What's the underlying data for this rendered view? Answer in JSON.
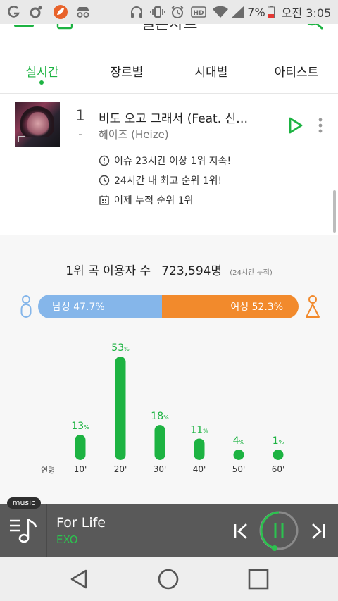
{
  "status_bar": {
    "battery": "7%",
    "time": "오전 3:05"
  },
  "header": {
    "title": "멜론차트",
    "menu_icon": "menu-icon",
    "search_icon": "search-icon"
  },
  "tabs": [
    {
      "label": "실시간",
      "active": true
    },
    {
      "label": "장르별",
      "active": false
    },
    {
      "label": "시대별",
      "active": false
    },
    {
      "label": "아티스트",
      "active": false
    }
  ],
  "song": {
    "rank": "1",
    "rank_change": "-",
    "title": "비도 오고 그래서 (Feat. 신…",
    "artist": "헤이즈 (Heize)",
    "info": [
      {
        "icon": "issue-icon",
        "text": "이슈 23시간 이상 1위 지속!"
      },
      {
        "icon": "clock-icon",
        "text": "24시간 내 최고 순위 1위!"
      },
      {
        "icon": "calendar-icon",
        "text": "어제 누적 순위 1위"
      }
    ]
  },
  "stats": {
    "users_label": "1위 곡 이용자 수",
    "users_count": "723,594명",
    "users_note": "(24시간 누적)",
    "male_label": "남성 47.7%",
    "female_label": "여성 52.3%",
    "male_ratio": 47.7,
    "female_ratio": 52.3,
    "colors": {
      "male": "#85b6ea",
      "female": "#f28a2c",
      "accent": "#1db342"
    }
  },
  "chart_data": {
    "type": "bar",
    "categories": [
      "10'",
      "20'",
      "30'",
      "40'",
      "50'",
      "60'"
    ],
    "values": [
      13,
      53,
      18,
      11,
      4,
      1
    ],
    "value_labels": [
      "13",
      "53",
      "18",
      "11",
      "4",
      "1"
    ],
    "unit": "%",
    "xlabel": "연령",
    "color": "#1db342"
  },
  "player": {
    "badge": "music",
    "title": "For Life",
    "artist": "EXO",
    "state": "playing"
  }
}
